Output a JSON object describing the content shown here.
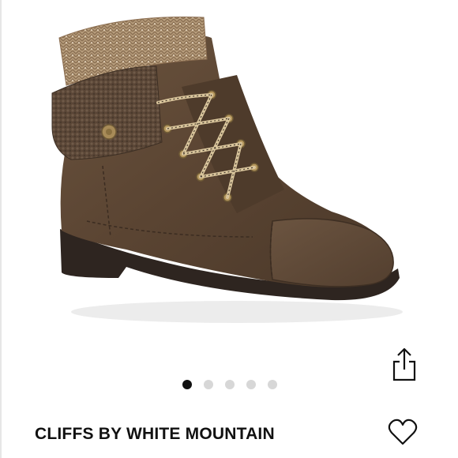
{
  "listing": {
    "brand_title": "CLIFFS BY WHITE MOUNTAIN"
  },
  "image": {
    "subject": "Brown lace-up ankle boot with knit cuff and sherpa fold-over collar"
  },
  "carousel": {
    "slides": 5,
    "active_index": 0
  },
  "actions": {
    "share_icon": "share-icon",
    "like_icon": "heart-icon"
  },
  "colors": {
    "boot_leather": "#5b4634",
    "sole": "#2e2520",
    "dot_active": "#111111",
    "dot_inactive": "#d7d7d7"
  }
}
